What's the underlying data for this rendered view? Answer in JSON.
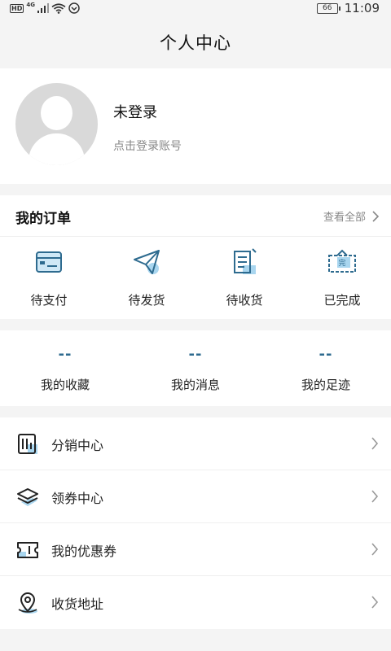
{
  "status_bar": {
    "hd": "HD",
    "network": "4G",
    "battery": "66",
    "time": "11:09"
  },
  "header": {
    "title": "个人中心"
  },
  "profile": {
    "name": "未登录",
    "subtitle": "点击登录账号"
  },
  "orders": {
    "title": "我的订单",
    "view_all": "查看全部",
    "items": [
      {
        "label": "待支付",
        "icon": "card-icon"
      },
      {
        "label": "待发货",
        "icon": "paper-plane-icon"
      },
      {
        "label": "待收货",
        "icon": "document-icon"
      },
      {
        "label": "已完成",
        "icon": "completed-box-icon"
      }
    ]
  },
  "stats": [
    {
      "value": "--",
      "label": "我的收藏"
    },
    {
      "value": "--",
      "label": "我的消息"
    },
    {
      "value": "--",
      "label": "我的足迹"
    }
  ],
  "menu": [
    {
      "label": "分销中心",
      "icon": "distribution-icon"
    },
    {
      "label": "领券中心",
      "icon": "layers-icon"
    },
    {
      "label": "我的优惠券",
      "icon": "ticket-icon"
    },
    {
      "label": "收货地址",
      "icon": "location-pin-icon"
    }
  ],
  "colors": {
    "accent": "#2e6b8f",
    "accent_light": "#a9d6ef",
    "background": "#f4f4f4",
    "card": "#ffffff"
  }
}
